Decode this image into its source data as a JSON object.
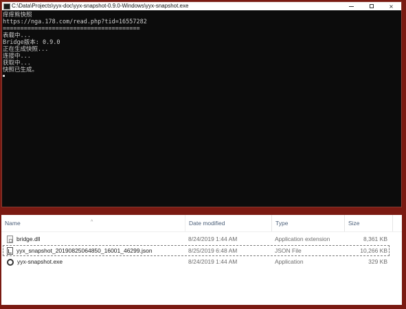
{
  "console": {
    "title": "C:\\Data\\Projects\\yyx-doc\\yyx-snapshot-0.9.0-Windows\\yyx-snapshot.exe",
    "lines": [
      "痒痒熊快照",
      "https://nga.178.com/read.php?tid=16557282",
      "=======================================",
      "表载中...",
      "Bridge版本: 0.9.0",
      "正在生成快照...",
      "连接中...",
      "获取中...",
      "快照已生成。"
    ],
    "controls": {
      "minimize": "minimize",
      "maximize": "maximize",
      "close": "×"
    }
  },
  "explorer": {
    "columns": {
      "name": "Name",
      "date": "Date modified",
      "type": "Type",
      "size": "Size"
    },
    "files": [
      {
        "name": "bridge.dll",
        "icon": "dll-file-icon",
        "date": "8/24/2019 1:44 AM",
        "type": "Application extension",
        "size": "8,361 KB"
      },
      {
        "name": "yyx_snapshot_20190825064850_16001_46299.json",
        "icon": "json-file-icon",
        "date": "8/25/2019 6:48 AM",
        "type": "JSON File",
        "size": "10,266 KB"
      },
      {
        "name": "yyx-snapshot.exe",
        "icon": "exe-file-icon",
        "date": "8/24/2019 1:44 AM",
        "type": "Application",
        "size": "329 KB"
      }
    ]
  }
}
